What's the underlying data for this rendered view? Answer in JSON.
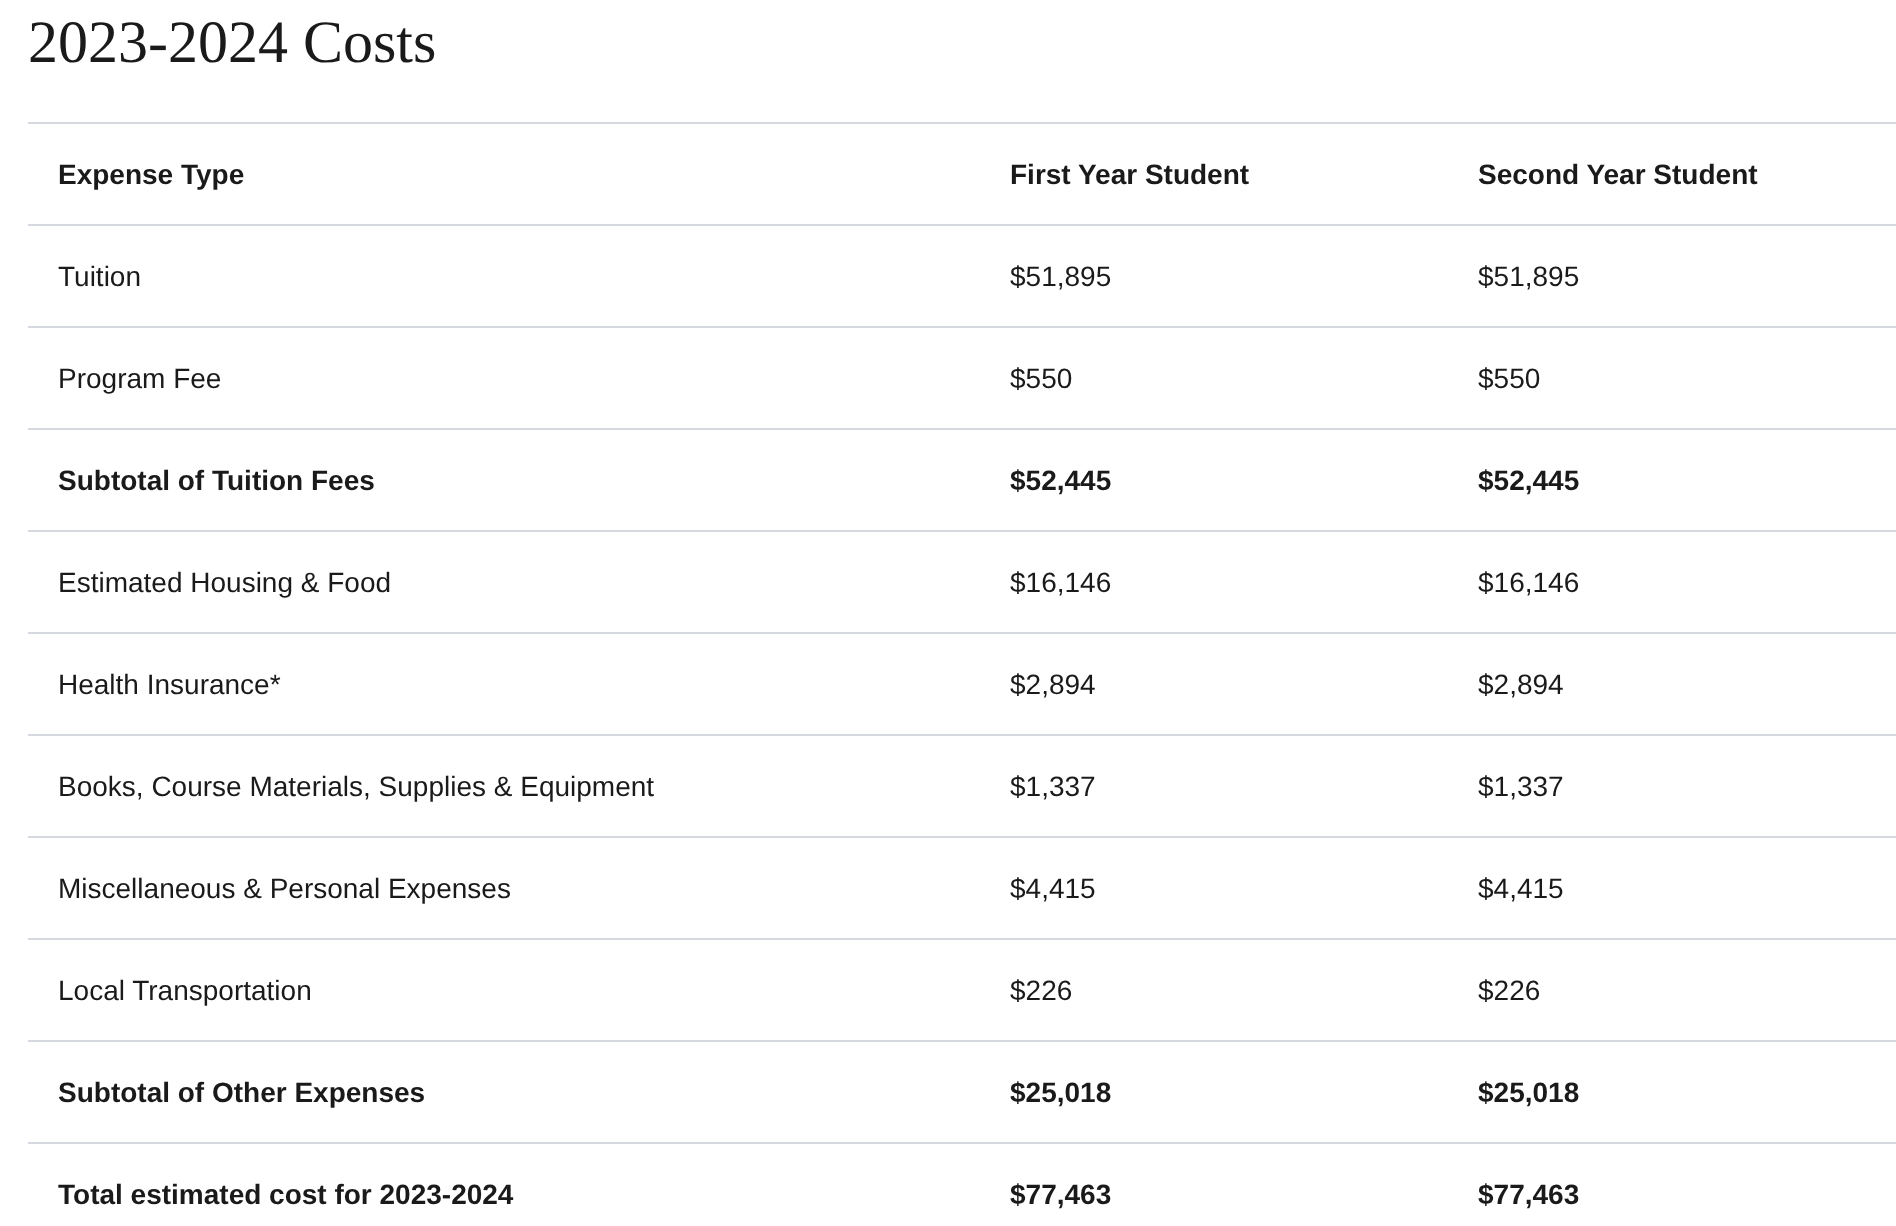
{
  "title": "2023-2024 Costs",
  "table": {
    "columns": [
      "Expense Type",
      "First Year Student",
      "Second Year Student"
    ],
    "rows": [
      {
        "kind": "item",
        "cells": [
          "Tuition",
          "$51,895",
          "$51,895"
        ]
      },
      {
        "kind": "item",
        "cells": [
          "Program Fee",
          "$550",
          "$550"
        ]
      },
      {
        "kind": "subtotal",
        "cells": [
          "Subtotal of Tuition Fees",
          "$52,445",
          "$52,445"
        ]
      },
      {
        "kind": "item",
        "cells": [
          "Estimated Housing & Food",
          "$16,146",
          "$16,146"
        ]
      },
      {
        "kind": "item",
        "cells": [
          "Health Insurance*",
          "$2,894",
          "$2,894"
        ]
      },
      {
        "kind": "item",
        "cells": [
          "Books, Course Materials, Supplies & Equipment",
          "$1,337",
          "$1,337"
        ]
      },
      {
        "kind": "item",
        "cells": [
          "Miscellaneous & Personal Expenses",
          "$4,415",
          "$4,415"
        ]
      },
      {
        "kind": "item",
        "cells": [
          "Local Transportation",
          "$226",
          "$226"
        ]
      },
      {
        "kind": "subtotal",
        "cells": [
          "Subtotal of Other Expenses",
          "$25,018",
          "$25,018"
        ]
      },
      {
        "kind": "total",
        "cells": [
          "Total estimated cost for 2023-2024",
          "$77,463",
          "$77,463"
        ]
      }
    ]
  }
}
